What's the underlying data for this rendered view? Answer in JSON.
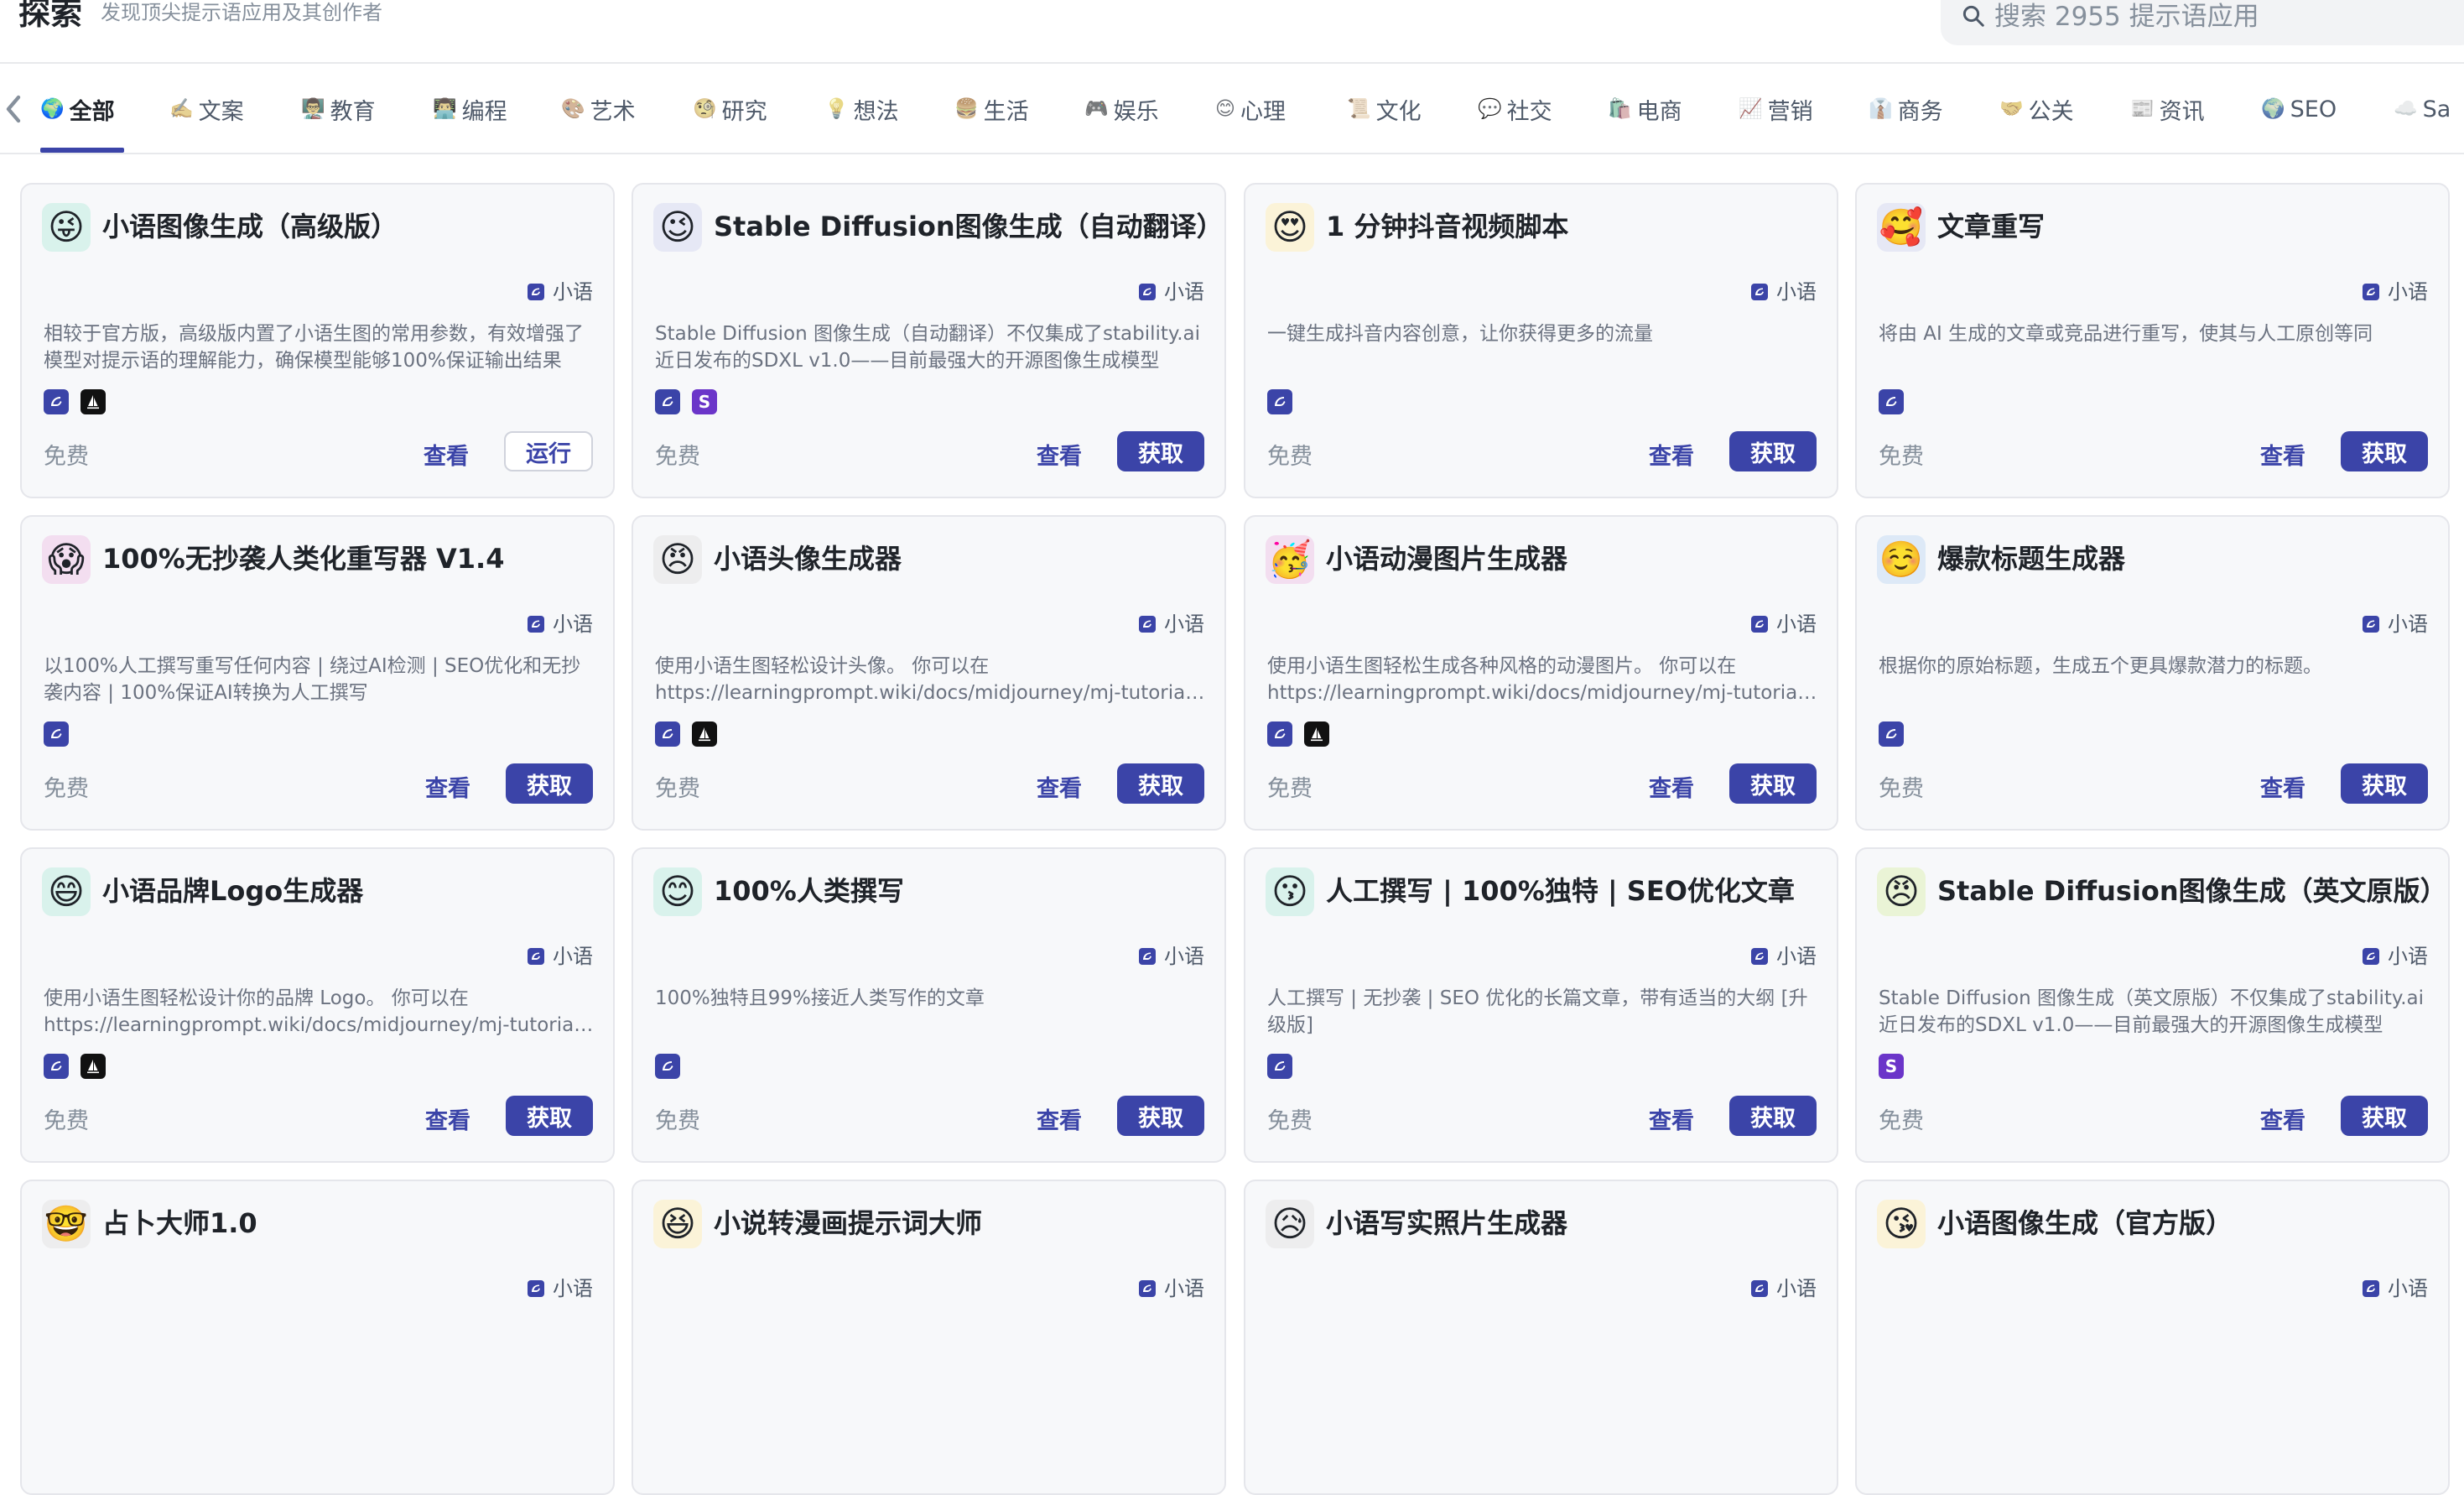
{
  "header": {
    "title": "探索",
    "subtitle": "发现顶尖提示语应用及其创作者",
    "search_placeholder": "搜索 2955 提示语应用"
  },
  "tabs": [
    {
      "icon": "🌍",
      "label": "全部",
      "active": true
    },
    {
      "icon": "✍️",
      "label": "文案"
    },
    {
      "icon": "👨‍🏫",
      "label": "教育"
    },
    {
      "icon": "👨‍💻",
      "label": "编程"
    },
    {
      "icon": "🎨",
      "label": "艺术"
    },
    {
      "icon": "🧐",
      "label": "研究"
    },
    {
      "icon": "💡",
      "label": "想法"
    },
    {
      "icon": "🍔",
      "label": "生活"
    },
    {
      "icon": "🎮",
      "label": "娱乐"
    },
    {
      "icon": "😊",
      "label": "心理"
    },
    {
      "icon": "📜",
      "label": "文化"
    },
    {
      "icon": "💬",
      "label": "社交"
    },
    {
      "icon": "🛍️",
      "label": "电商"
    },
    {
      "icon": "📈",
      "label": "营销"
    },
    {
      "icon": "👔",
      "label": "商务"
    },
    {
      "icon": "🤝",
      "label": "公关"
    },
    {
      "icon": "📰",
      "label": "资讯"
    },
    {
      "icon": "🌍",
      "label": "SEO"
    },
    {
      "icon": "☁️",
      "label": "Sa"
    }
  ],
  "cards": [
    {
      "emoji": "😜",
      "bg": "#d9f2ec",
      "title": "小语图像生成（高级版）",
      "author": "小语",
      "desc": "相较于官方版，高级版内置了小语生图的常用参数，有效增强了模型对提示语的理解能力，确保模型能够100%保证输出结果",
      "models": [
        "xy",
        "mj"
      ],
      "price": "免费",
      "view": "查看",
      "action": "运行",
      "action_style": "outline"
    },
    {
      "emoji": "😉",
      "bg": "#e6e8f5",
      "title": "Stable Diffusion图像生成（自动翻译）",
      "author": "小语",
      "desc": "Stable Diffusion 图像生成（自动翻译）不仅集成了stability.ai 近日发布的SDXL v1.0——目前最强大的开源图像生成模型",
      "models": [
        "xy",
        "sd"
      ],
      "price": "免费",
      "view": "查看",
      "action": "获取",
      "action_style": "solid"
    },
    {
      "emoji": "😍",
      "bg": "#fbf3d8",
      "title": "1 分钟抖音视频脚本",
      "author": "小语",
      "desc": "一键生成抖音内容创意，让你获得更多的流量",
      "models": [
        "xy"
      ],
      "price": "免费",
      "view": "查看",
      "action": "获取",
      "action_style": "solid"
    },
    {
      "emoji": "🥰",
      "bg": "#e6e8f5",
      "title": "文章重写",
      "author": "小语",
      "desc": "将由 AI 生成的文章或竞品进行重写，使其与人工原创等同",
      "models": [
        "xy"
      ],
      "price": "免费",
      "view": "查看",
      "action": "获取",
      "action_style": "solid"
    },
    {
      "emoji": "😱",
      "bg": "#f3def0",
      "title": "100%无抄袭人类化重写器 V1.4",
      "author": "小语",
      "desc": "以100%人工撰写重写任何内容 | 绕过AI检测 | SEO优化和无抄袭内容 | 100%保证AI转换为人工撰写",
      "models": [
        "xy"
      ],
      "price": "免费",
      "view": "查看",
      "action": "获取",
      "action_style": "solid"
    },
    {
      "emoji": "😠",
      "bg": "#ededee",
      "title": "小语头像生成器",
      "author": "小语",
      "desc": "使用小语生图轻松设计头像。 你可以在 https://learningprompt.wiki/docs/midjourney/mj-tutorial-basics",
      "models": [
        "xy",
        "mj"
      ],
      "price": "免费",
      "view": "查看",
      "action": "获取",
      "action_style": "solid"
    },
    {
      "emoji": "🥳",
      "bg": "#f3def0",
      "title": "小语动漫图片生成器",
      "author": "小语",
      "desc": "使用小语生图轻松生成各种风格的动漫图片。 你可以在 https://learningprompt.wiki/docs/midjourney/mj-tutorial-basics",
      "models": [
        "xy",
        "mj"
      ],
      "price": "免费",
      "view": "查看",
      "action": "获取",
      "action_style": "solid"
    },
    {
      "emoji": "☺️",
      "bg": "#dde9f7",
      "title": "爆款标题生成器",
      "author": "小语",
      "desc": "根据你的原始标题，生成五个更具爆款潜力的标题。",
      "models": [
        "xy"
      ],
      "price": "免费",
      "view": "查看",
      "action": "获取",
      "action_style": "solid"
    },
    {
      "emoji": "😄",
      "bg": "#d9f2ec",
      "title": "小语品牌Logo生成器",
      "author": "小语",
      "desc": "使用小语生图轻松设计你的品牌 Logo。 你可以在 https://learningprompt.wiki/docs/midjourney/mj-tutorial-basics",
      "models": [
        "xy",
        "mj"
      ],
      "price": "免费",
      "view": "查看",
      "action": "获取",
      "action_style": "solid"
    },
    {
      "emoji": "😊",
      "bg": "#d9f2ec",
      "title": "100%人类撰写",
      "author": "小语",
      "desc": "100%独特且99%接近人类写作的文章",
      "models": [
        "xy"
      ],
      "price": "免费",
      "view": "查看",
      "action": "获取",
      "action_style": "solid"
    },
    {
      "emoji": "😗",
      "bg": "#d9f2ec",
      "title": "人工撰写 | 100%独特 | SEO优化文章",
      "author": "小语",
      "desc": "人工撰写 | 无抄袭 | SEO 优化的长篇文章，带有适当的大纲 [升级版]",
      "models": [
        "xy"
      ],
      "price": "免费",
      "view": "查看",
      "action": "获取",
      "action_style": "solid"
    },
    {
      "emoji": "😠",
      "bg": "#eaf4d6",
      "title": "Stable Diffusion图像生成（英文原版）",
      "author": "小语",
      "desc": "Stable Diffusion 图像生成（英文原版）不仅集成了stability.ai 近日发布的SDXL v1.0——目前最强大的开源图像生成模型",
      "models": [
        "sd"
      ],
      "price": "免费",
      "view": "查看",
      "action": "获取",
      "action_style": "solid"
    },
    {
      "emoji": "🤓",
      "bg": "#ededee",
      "title": "占卜大师1.0",
      "author": "小语",
      "desc": "",
      "models": [],
      "price": "",
      "view": "",
      "action": "",
      "action_style": "none"
    },
    {
      "emoji": "😆",
      "bg": "#fbf3d8",
      "title": "小说转漫画提示词大师",
      "author": "小语",
      "desc": "",
      "models": [],
      "price": "",
      "view": "",
      "action": "",
      "action_style": "none"
    },
    {
      "emoji": "😥",
      "bg": "#ededee",
      "title": "小语写实照片生成器",
      "author": "小语",
      "desc": "",
      "models": [],
      "price": "",
      "view": "",
      "action": "",
      "action_style": "none"
    },
    {
      "emoji": "😘",
      "bg": "#fbf3d8",
      "title": "小语图像生成（官方版）",
      "author": "小语",
      "desc": "",
      "models": [],
      "price": "",
      "view": "",
      "action": "",
      "action_style": "none"
    }
  ]
}
